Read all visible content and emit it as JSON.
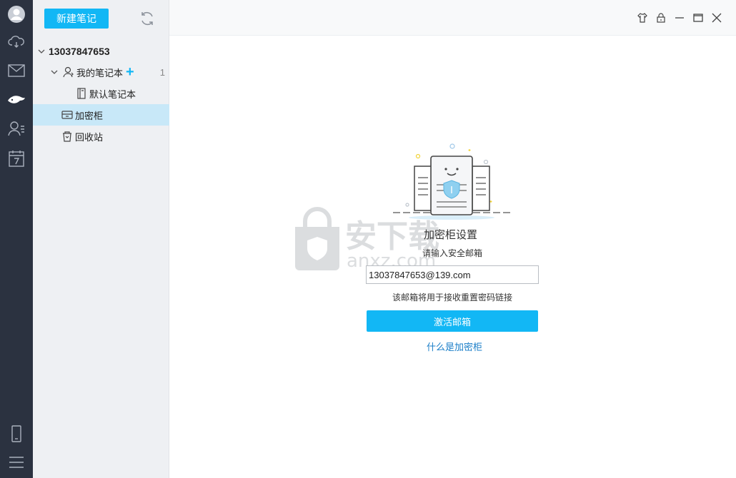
{
  "toolbar": {
    "new_note_label": "新建笔记"
  },
  "tree": {
    "account": "13037847653",
    "my_notebooks": {
      "label": "我的笔记本",
      "count": "1",
      "add_symbol": "+"
    },
    "default_notebook": "默认笔记本",
    "vault": "加密柜",
    "trash": "回收站"
  },
  "vault_setup": {
    "title": "加密柜设置",
    "prompt": "请输入安全邮箱",
    "email_value": "13037847653@139.com",
    "note": "该邮箱将用于接收重置密码链接",
    "activate_label": "激活邮箱",
    "help_link": "什么是加密柜"
  },
  "watermark": {
    "text_cn": "安下载",
    "text_en": "anxz.com"
  },
  "rail_icons": [
    "avatar-icon",
    "cloud-icon",
    "mail-icon",
    "note-app-icon",
    "contacts-icon",
    "calendar-icon",
    "phone-icon",
    "menu-icon"
  ],
  "window_icons": [
    "skin-icon",
    "lock-icon",
    "minimize-icon",
    "maximize-icon",
    "close-icon"
  ],
  "colors": {
    "accent": "#12b7f5",
    "rail": "#2b3240",
    "selected_row": "#c8e8f8",
    "link": "#1a7ec8"
  }
}
